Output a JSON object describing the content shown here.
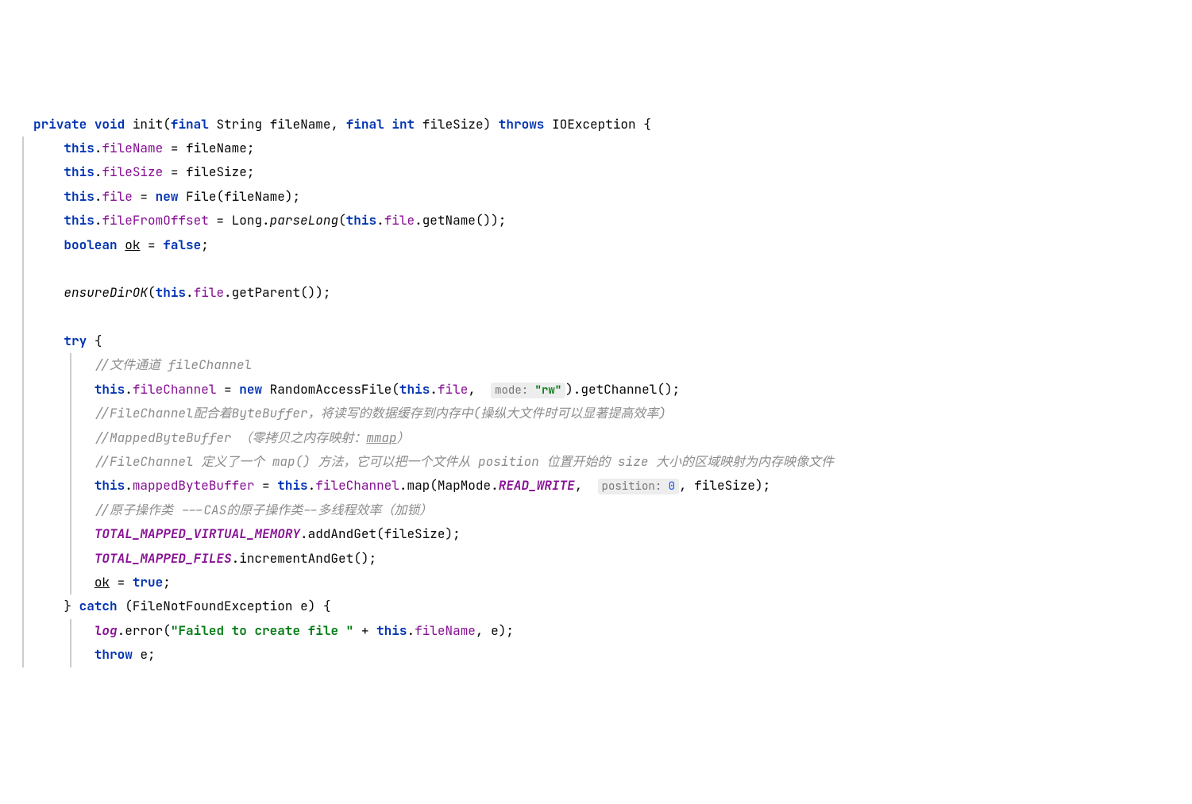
{
  "code": {
    "l1": {
      "private": "private",
      "void": "void",
      "init": "init",
      "lp": "(",
      "final1": "final",
      "string": "String",
      "fileName": "fileName",
      "comma": ",",
      "final2": "final",
      "int": "int",
      "fileSize": "fileSize",
      "rp": ")",
      "throws": "throws",
      "exc": "IOException",
      "lb": " {"
    },
    "l2": {
      "this": "this",
      "dot": ".",
      "field": "fileName",
      "eq": " = ",
      "val": "fileName",
      "sc": ";"
    },
    "l3": {
      "this": "this",
      "dot": ".",
      "field": "fileSize",
      "eq": " = ",
      "val": "fileSize",
      "sc": ";"
    },
    "l4": {
      "this": "this",
      "dot": ".",
      "field": "file",
      "eq": " = ",
      "new": "new",
      "type": "File",
      "lp": "(",
      "arg": "fileName",
      "rp": ")",
      "sc": ";"
    },
    "l5": {
      "this": "this",
      "dot1": ".",
      "field": "fileFromOffset",
      "eq": " = ",
      "long": "Long",
      "dot2": ".",
      "parse": "parseLong",
      "lp": "(",
      "this2": "this",
      "dot3": ".",
      "file": "file",
      "dot4": ".",
      "getName": "getName",
      "lp2": "(",
      "rp2": ")",
      "rp": ")",
      "sc": ";"
    },
    "l6": {
      "boolean": "boolean",
      "ok": "ok",
      "eq": " = ",
      "false": "false",
      "sc": ";"
    },
    "l7": {},
    "l8": {
      "ensure": "ensureDirOK",
      "lp": "(",
      "this": "this",
      "dot": ".",
      "file": "file",
      "dot2": ".",
      "getParent": "getParent",
      "lp2": "(",
      "rp2": ")",
      "rp": ")",
      "sc": ";"
    },
    "l9": {},
    "l10": {
      "try": "try",
      "lb": " {"
    },
    "l11": {
      "c": "//文件通道 fileChannel"
    },
    "l12": {
      "this": "this",
      "dot": ".",
      "field": "fileChannel",
      "eq": " = ",
      "new": "new",
      "type": "RandomAccessFile",
      "lp": "(",
      "this2": "this",
      "dot2": ".",
      "file": "file",
      "comma": ", ",
      "hint": "mode:",
      "str": "\"rw\"",
      "rp": ")",
      "dot3": ".",
      "getChannel": "getChannel",
      "lp2": "(",
      "rp2": ")",
      "sc": ";"
    },
    "l13": {
      "c": "//FileChannel配合着ByteBuffer，将读写的数据缓存到内存中(操纵大文件时可以显著提高效率)"
    },
    "l14": {
      "c1": "//MappedByteBuffer （零拷贝之内存映射：",
      "mmap": "mmap",
      "c2": "）"
    },
    "l15": {
      "c": "//FileChannel 定义了一个 map() 方法，它可以把一个文件从 position 位置开始的 size 大小的区域映射为内存映像文件"
    },
    "l16": {
      "this": "this",
      "dot": ".",
      "field": "mappedByteBuffer",
      "eq": " = ",
      "this2": "this",
      "dot2": ".",
      "fc": "fileChannel",
      "dot3": ".",
      "map": "map",
      "lp": "(",
      "mapmode": "MapMode",
      "dot4": ".",
      "rw": "READ_WRITE",
      "comma": ", ",
      "hint": "position:",
      "zero": "0",
      "comma2": ", ",
      "fs": "fileSize",
      "rp": ")",
      "sc": ";"
    },
    "l17": {
      "c": "//原子操作类 ---CAS的原子操作类--多线程效率（加锁）"
    },
    "l18": {
      "tm": "TOTAL_MAPPED_VIRTUAL_MEMORY",
      "dot": ".",
      "m": "addAndGet",
      "lp": "(",
      "arg": "fileSize",
      "rp": ")",
      "sc": ";"
    },
    "l19": {
      "tm": "TOTAL_MAPPED_FILES",
      "dot": ".",
      "m": "incrementAndGet",
      "lp": "(",
      "rp": ")",
      "sc": ";"
    },
    "l20": {
      "ok": "ok",
      "eq": " = ",
      "true": "true",
      "sc": ";"
    },
    "l21": {
      "rb": "}",
      "catch": "catch",
      "lp": "(",
      "type": "FileNotFoundException",
      "e": "e",
      "rp": ")",
      "lb": " {"
    },
    "l22": {
      "log": "log",
      "dot": ".",
      "error": "error",
      "lp": "(",
      "str": "\"Failed to create file \"",
      "plus": " + ",
      "this": "this",
      "dot2": ".",
      "field": "fileName",
      "comma": ", ",
      "e": "e",
      "rp": ")",
      "sc": ";"
    },
    "l23": {
      "throw": "throw",
      "e": "e",
      "sc": ";"
    }
  }
}
